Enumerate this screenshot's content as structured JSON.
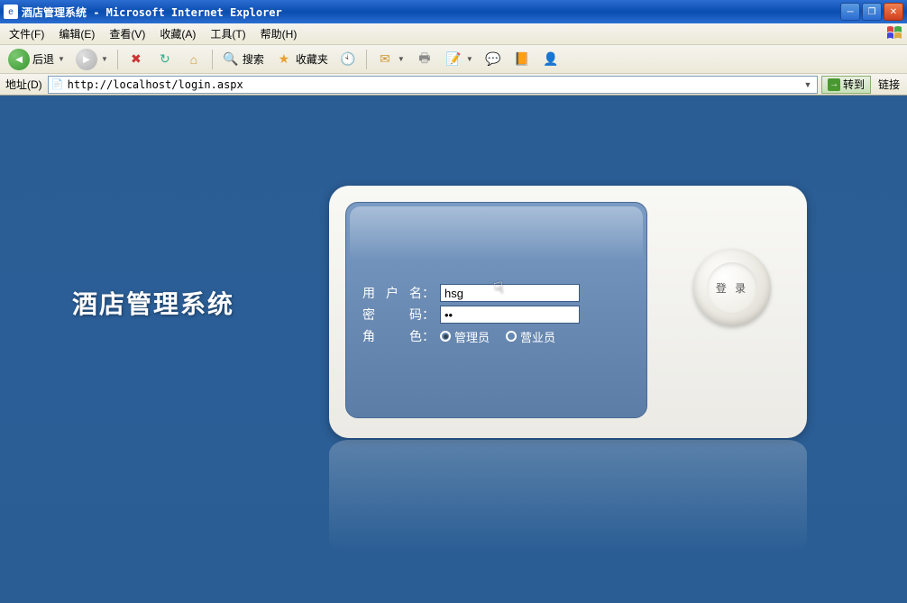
{
  "window": {
    "title": "酒店管理系统 - Microsoft Internet Explorer"
  },
  "menu": {
    "file": "文件(F)",
    "edit": "编辑(E)",
    "view": "查看(V)",
    "favorites": "收藏(A)",
    "tools": "工具(T)",
    "help": "帮助(H)"
  },
  "toolbar": {
    "back": "后退",
    "search": "搜索",
    "favorites": "收藏夹"
  },
  "address": {
    "label": "地址(D)",
    "url": "http://localhost/login.aspx",
    "go": "转到",
    "links": "链接"
  },
  "page": {
    "system_title": "酒店管理系统",
    "login_button": "登 录",
    "form": {
      "username_label": "用户名",
      "username_value": "hsg",
      "password_label": "密　码",
      "password_value": "••",
      "role_label": "角　色",
      "role_admin": "管理员",
      "role_sales": "营业员"
    },
    "colon": "："
  }
}
